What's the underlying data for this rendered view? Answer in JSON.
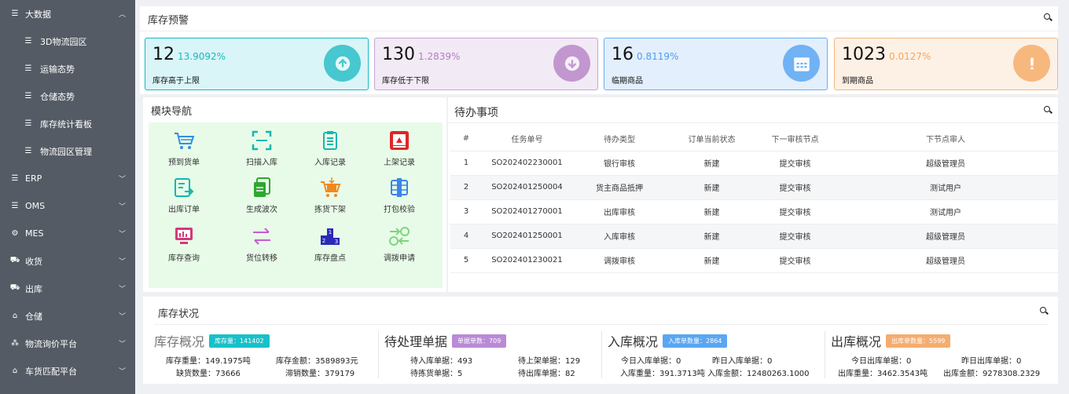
{
  "sidebar": {
    "items": [
      {
        "label": "大数据",
        "icon": "list-icon",
        "type": "top",
        "expanded": true
      },
      {
        "label": "3D物流园区",
        "icon": "list-icon",
        "type": "sub"
      },
      {
        "label": "运输态势",
        "icon": "list-icon",
        "type": "sub"
      },
      {
        "label": "仓储态势",
        "icon": "list-icon",
        "type": "sub"
      },
      {
        "label": "库存统计看板",
        "icon": "list-icon",
        "type": "sub"
      },
      {
        "label": "物流园区管理",
        "icon": "list-icon",
        "type": "sub"
      },
      {
        "label": "ERP",
        "icon": "list-icon",
        "type": "top"
      },
      {
        "label": "OMS",
        "icon": "list-icon",
        "type": "top"
      },
      {
        "label": "MES",
        "icon": "gear-icon",
        "type": "top"
      },
      {
        "label": "收货",
        "icon": "truck-icon",
        "type": "top"
      },
      {
        "label": "出库",
        "icon": "truck-icon",
        "type": "top"
      },
      {
        "label": "仓储",
        "icon": "home-icon",
        "type": "top"
      },
      {
        "label": "物流询价平台",
        "icon": "cluster-icon",
        "type": "top"
      },
      {
        "label": "车货匹配平台",
        "icon": "home-icon",
        "type": "top"
      }
    ]
  },
  "alert": {
    "title": "库存预警",
    "cards": [
      {
        "value": "12",
        "pct": "13.9092%",
        "label": "库存高于上限",
        "icon": "arrow-up-icon",
        "color": "#17b8c2",
        "bg": "#d9f5f7",
        "border": "#17b8c2"
      },
      {
        "value": "130",
        "pct": "1.2839%",
        "label": "库存低于下限",
        "icon": "arrow-down-icon",
        "color": "#b27cc4",
        "bg": "#f2eaf5",
        "border": "#c9a5d5"
      },
      {
        "value": "16",
        "pct": "0.8119%",
        "label": "临期商品",
        "icon": "calendar-icon",
        "color": "#4a9ef0",
        "bg": "#e3effc",
        "border": "#6aaef2"
      },
      {
        "value": "1023",
        "pct": "0.0127%",
        "label": "到期商品",
        "icon": "exclamation-icon",
        "color": "#f5a55c",
        "bg": "#fdf1e6",
        "border": "#f3b77f"
      }
    ]
  },
  "modules": {
    "title": "模块导航",
    "items": [
      {
        "label": "预到货单",
        "icon": "cart-icon",
        "color": "#2f8fe6"
      },
      {
        "label": "扫描入库",
        "icon": "scan-icon",
        "color": "#16b6b0"
      },
      {
        "label": "入库记录",
        "icon": "clipboard-icon",
        "color": "#16b6b0"
      },
      {
        "label": "上架记录",
        "icon": "shelf-icon",
        "color": "#e02525"
      },
      {
        "label": "出库订单",
        "icon": "export-icon",
        "color": "#16b6b0"
      },
      {
        "label": "生成波次",
        "icon": "copy-icon",
        "color": "#2ea82e"
      },
      {
        "label": "拣货下架",
        "icon": "cart-down-icon",
        "color": "#f0891d"
      },
      {
        "label": "打包校验",
        "icon": "package-icon",
        "color": "#3a86e8"
      },
      {
        "label": "库存查询",
        "icon": "monitor-icon",
        "color": "#d23a7a"
      },
      {
        "label": "货位转移",
        "icon": "transfer-icon",
        "color": "#c85ad8"
      },
      {
        "label": "库存盘点",
        "icon": "ranking-icon",
        "color": "#2a2ab8"
      },
      {
        "label": "调拨申请",
        "icon": "exchange-icon",
        "color": "#7cd67c"
      }
    ]
  },
  "todo": {
    "title": "待办事项",
    "columns": [
      "#",
      "任务单号",
      "待办类型",
      "订单当前状态",
      "下一审核节点",
      "下节点审人"
    ],
    "rows": [
      [
        "1",
        "SO202402230001",
        "银行审核",
        "新建",
        "提交审核",
        "超级管理员"
      ],
      [
        "2",
        "SO202401250004",
        "货主商品抵押",
        "新建",
        "提交审核",
        "测试用户"
      ],
      [
        "3",
        "SO202401270001",
        "出库审核",
        "新建",
        "提交审核",
        "测试用户"
      ],
      [
        "4",
        "SO202401250001",
        "入库审核",
        "新建",
        "提交审核",
        "超级管理员"
      ],
      [
        "5",
        "SO202401230021",
        "调拨审核",
        "新建",
        "提交审核",
        "超级管理员"
      ]
    ]
  },
  "inventory": {
    "title": "库存状况",
    "sections": [
      {
        "heading": "库存概况",
        "badge": "库存量：141402",
        "badge_color": "#17c1c9",
        "kv": [
          "库存重量：149.1975吨",
          "库存金额：3589893元",
          "缺货数量：73666",
          "滞销数量：379179"
        ]
      },
      {
        "heading": "待处理单据",
        "badge": "单据单数：709",
        "badge_color": "#b98ad6",
        "kv": [
          "待入库单据：493",
          "待上架单据：129",
          "待拣货单据：5",
          "待出库单据：82"
        ]
      },
      {
        "heading": "入库概况",
        "badge": "入库单数量：2864",
        "badge_color": "#5aa6f2",
        "kv": [
          "今日入库单据：0",
          "昨日入库单据：0",
          "入库重量：391.3713吨",
          "入库金额：12480263.1000"
        ]
      },
      {
        "heading": "出库概况",
        "badge": "出库单数量：5599",
        "badge_color": "#f5ad6e",
        "kv": [
          "今日出库单据：0",
          "昨日出库单据：0",
          "出库重量：3462.3543吨",
          "出库金额：9278308.2329"
        ]
      }
    ]
  }
}
